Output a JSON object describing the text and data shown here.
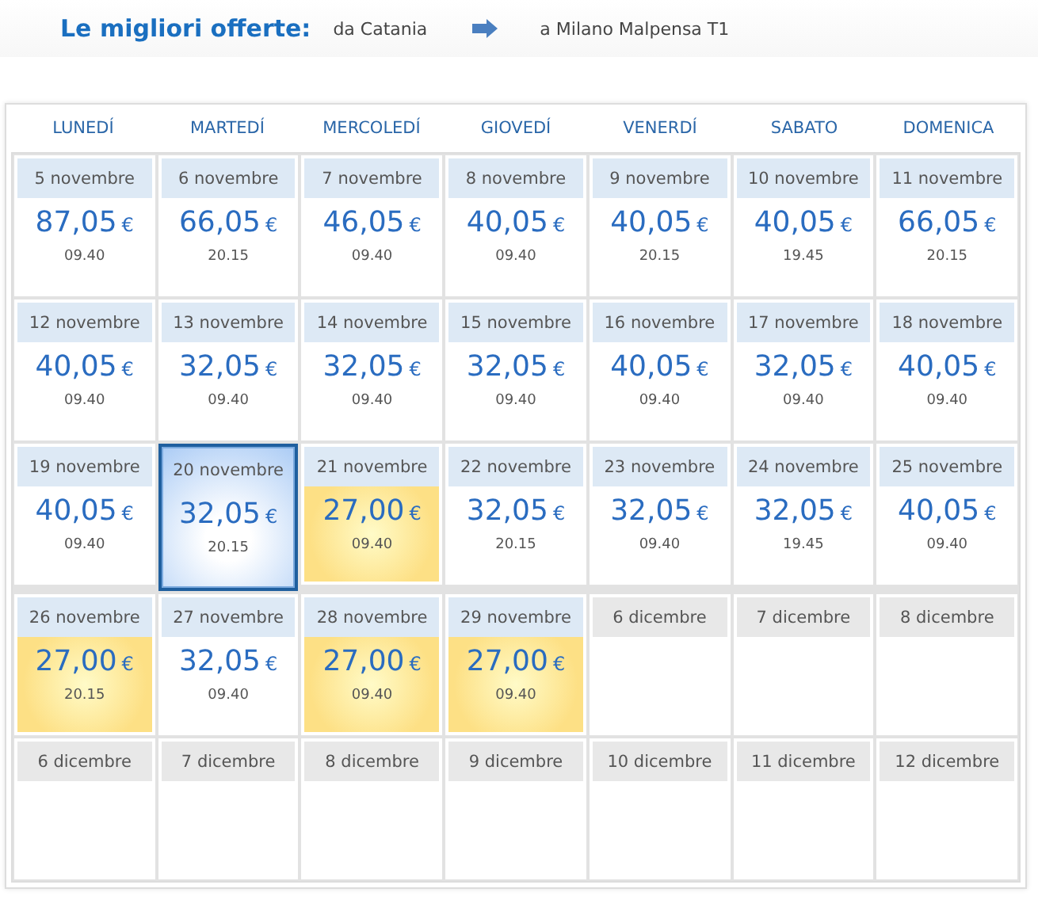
{
  "header": {
    "title": "Le migliori offerte:",
    "from": "da Catania",
    "to": "a Milano Malpensa T1"
  },
  "weekdays": [
    "LUNEDÍ",
    "MARTEDÍ",
    "MERCOLEDÍ",
    "GIOVEDÍ",
    "VENERDÍ",
    "SABATO",
    "DOMENICA"
  ],
  "weeks": [
    [
      {
        "kind": "offer",
        "date": "5 novembre",
        "price": "87,05",
        "currency": "€",
        "time": "09.40",
        "cheapest": false,
        "selected": false
      },
      {
        "kind": "offer",
        "date": "6 novembre",
        "price": "66,05",
        "currency": "€",
        "time": "20.15",
        "cheapest": false,
        "selected": false
      },
      {
        "kind": "offer",
        "date": "7 novembre",
        "price": "46,05",
        "currency": "€",
        "time": "09.40",
        "cheapest": false,
        "selected": false
      },
      {
        "kind": "offer",
        "date": "8 novembre",
        "price": "40,05",
        "currency": "€",
        "time": "09.40",
        "cheapest": false,
        "selected": false
      },
      {
        "kind": "offer",
        "date": "9 novembre",
        "price": "40,05",
        "currency": "€",
        "time": "20.15",
        "cheapest": false,
        "selected": false
      },
      {
        "kind": "offer",
        "date": "10 novembre",
        "price": "40,05",
        "currency": "€",
        "time": "19.45",
        "cheapest": false,
        "selected": false
      },
      {
        "kind": "offer",
        "date": "11 novembre",
        "price": "66,05",
        "currency": "€",
        "time": "20.15",
        "cheapest": false,
        "selected": false
      }
    ],
    [
      {
        "kind": "offer",
        "date": "12 novembre",
        "price": "40,05",
        "currency": "€",
        "time": "09.40",
        "cheapest": false,
        "selected": false
      },
      {
        "kind": "offer",
        "date": "13 novembre",
        "price": "32,05",
        "currency": "€",
        "time": "09.40",
        "cheapest": false,
        "selected": false
      },
      {
        "kind": "offer",
        "date": "14 novembre",
        "price": "32,05",
        "currency": "€",
        "time": "09.40",
        "cheapest": false,
        "selected": false
      },
      {
        "kind": "offer",
        "date": "15 novembre",
        "price": "32,05",
        "currency": "€",
        "time": "09.40",
        "cheapest": false,
        "selected": false
      },
      {
        "kind": "offer",
        "date": "16 novembre",
        "price": "40,05",
        "currency": "€",
        "time": "09.40",
        "cheapest": false,
        "selected": false
      },
      {
        "kind": "offer",
        "date": "17 novembre",
        "price": "32,05",
        "currency": "€",
        "time": "09.40",
        "cheapest": false,
        "selected": false
      },
      {
        "kind": "offer",
        "date": "18 novembre",
        "price": "40,05",
        "currency": "€",
        "time": "09.40",
        "cheapest": false,
        "selected": false
      }
    ],
    [
      {
        "kind": "offer",
        "date": "19 novembre",
        "price": "40,05",
        "currency": "€",
        "time": "09.40",
        "cheapest": false,
        "selected": false
      },
      {
        "kind": "offer",
        "date": "20 novembre",
        "price": "32,05",
        "currency": "€",
        "time": "20.15",
        "cheapest": false,
        "selected": true
      },
      {
        "kind": "offer",
        "date": "21 novembre",
        "price": "27,00",
        "currency": "€",
        "time": "09.40",
        "cheapest": true,
        "selected": false
      },
      {
        "kind": "offer",
        "date": "22 novembre",
        "price": "32,05",
        "currency": "€",
        "time": "20.15",
        "cheapest": false,
        "selected": false
      },
      {
        "kind": "offer",
        "date": "23 novembre",
        "price": "32,05",
        "currency": "€",
        "time": "09.40",
        "cheapest": false,
        "selected": false
      },
      {
        "kind": "offer",
        "date": "24 novembre",
        "price": "32,05",
        "currency": "€",
        "time": "19.45",
        "cheapest": false,
        "selected": false
      },
      {
        "kind": "offer",
        "date": "25 novembre",
        "price": "40,05",
        "currency": "€",
        "time": "09.40",
        "cheapest": false,
        "selected": false
      }
    ],
    [
      {
        "kind": "offer",
        "date": "26 novembre",
        "price": "27,00",
        "currency": "€",
        "time": "20.15",
        "cheapest": true,
        "selected": false
      },
      {
        "kind": "offer",
        "date": "27 novembre",
        "price": "32,05",
        "currency": "€",
        "time": "09.40",
        "cheapest": false,
        "selected": false
      },
      {
        "kind": "offer",
        "date": "28 novembre",
        "price": "27,00",
        "currency": "€",
        "time": "09.40",
        "cheapest": true,
        "selected": false
      },
      {
        "kind": "offer",
        "date": "29 novembre",
        "price": "27,00",
        "currency": "€",
        "time": "09.40",
        "cheapest": true,
        "selected": false
      },
      {
        "kind": "none",
        "date": "6 dicembre",
        "selected": false
      },
      {
        "kind": "none",
        "date": "7 dicembre",
        "selected": false
      },
      {
        "kind": "none",
        "date": "8 dicembre",
        "selected": false
      }
    ],
    [
      {
        "kind": "none",
        "date": "6 dicembre",
        "selected": false
      },
      {
        "kind": "none",
        "date": "7 dicembre",
        "selected": false
      },
      {
        "kind": "none",
        "date": "8 dicembre",
        "selected": false
      },
      {
        "kind": "none",
        "date": "9 dicembre",
        "selected": false
      },
      {
        "kind": "none",
        "date": "10 dicembre",
        "selected": false
      },
      {
        "kind": "none",
        "date": "11 dicembre",
        "selected": false
      },
      {
        "kind": "none",
        "date": "12 dicembre",
        "selected": false
      }
    ]
  ]
}
